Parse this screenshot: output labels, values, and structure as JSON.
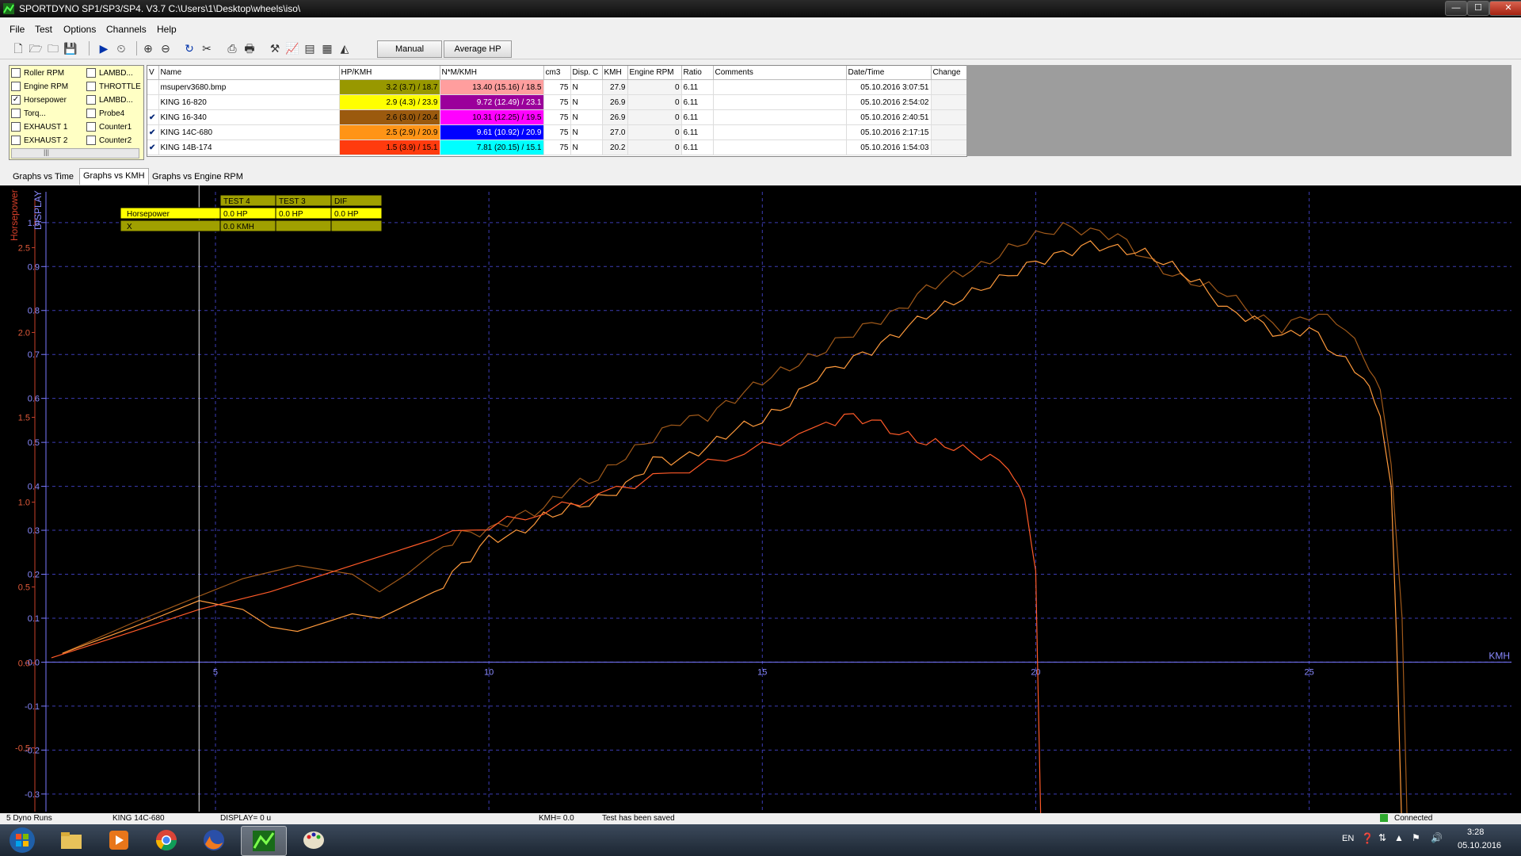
{
  "window": {
    "title": "SPORTDYNO SP1/SP3/SP4. V3.7  C:\\Users\\1\\Desktop\\wheels\\iso\\",
    "minimize": "—",
    "maximize": "☐",
    "close": "✕"
  },
  "menu": [
    "File",
    "Test",
    "Options",
    "Channels",
    "Help"
  ],
  "toolbar": {
    "manual_label": "Manual",
    "average_label": "Average HP"
  },
  "channels": [
    {
      "label": "Roller RPM",
      "checked": false
    },
    {
      "label": "LAMBD...",
      "checked": false
    },
    {
      "label": "Engine RPM",
      "checked": false
    },
    {
      "label": "THROTTLE",
      "checked": false
    },
    {
      "label": "Horsepower",
      "checked": true
    },
    {
      "label": "LAMBD...",
      "checked": false
    },
    {
      "label": "Torq...",
      "checked": false
    },
    {
      "label": "Probe4",
      "checked": false
    },
    {
      "label": "EXHAUST 1",
      "checked": false
    },
    {
      "label": "Counter1",
      "checked": false
    },
    {
      "label": "EXHAUST 2",
      "checked": false
    },
    {
      "label": "Counter2",
      "checked": false
    }
  ],
  "channels_scroll": "|||",
  "runs": {
    "headers": [
      "V",
      "Name",
      "HP/KMH",
      "N*M/KMH",
      "cm3",
      "Disp. C",
      "KMH",
      "Engine RPM",
      "Ratio",
      "Comments",
      "Date/Time",
      "Change"
    ],
    "rows": [
      {
        "checked": false,
        "name": "msuperv3680.bmp",
        "hp": "3.2 (3.7) / 18.7",
        "hp_color": "#989800",
        "nm": "13.40 (15.16) / 18.5",
        "nm_color": "#ff9e9e",
        "cm3": "75",
        "disp": "N",
        "kmh": "27.9",
        "rpm": "0",
        "ratio": "6.11",
        "comments": "",
        "date": "05.10.2016 3:07:51"
      },
      {
        "checked": false,
        "name": "KING 16-820",
        "hp": "2.9 (4.3) / 23.9",
        "hp_color": "#ffff00",
        "nm": "9.72 (12.49) / 23.1",
        "nm_color": "#9b009b",
        "cm3": "75",
        "disp": "N",
        "kmh": "26.9",
        "rpm": "0",
        "ratio": "6.11",
        "comments": "",
        "date": "05.10.2016 2:54:02"
      },
      {
        "checked": true,
        "name": "KING 16-340",
        "hp": "2.6 (3.0) / 20.4",
        "hp_color": "#9b5a0e",
        "nm": "10.31 (12.25) / 19.5",
        "nm_color": "#ff00ff",
        "cm3": "75",
        "disp": "N",
        "kmh": "26.9",
        "rpm": "0",
        "ratio": "6.11",
        "comments": "",
        "date": "05.10.2016 2:40:51"
      },
      {
        "checked": true,
        "name": "KING 14C-680",
        "hp": "2.5 (2.9) / 20.9",
        "hp_color": "#ff9416",
        "nm": "9.61 (10.92) / 20.9",
        "nm_color": "#0000ff",
        "cm3": "75",
        "disp": "N",
        "kmh": "27.0",
        "rpm": "0",
        "ratio": "6.11",
        "comments": "",
        "date": "05.10.2016 2:17:15"
      },
      {
        "checked": true,
        "name": "KING 14B-174",
        "hp": "1.5 (3.9) / 15.1",
        "hp_color": "#ff3b0e",
        "nm": "7.81 (20.15) / 15.1",
        "nm_color": "#00ffff",
        "cm3": "75",
        "disp": "N",
        "kmh": "20.2",
        "rpm": "0",
        "ratio": "6.11",
        "comments": "",
        "date": "05.10.2016 1:54:03"
      }
    ]
  },
  "tabs": [
    {
      "label": "Graphs vs Time",
      "active": false
    },
    {
      "label": "Graphs vs KMH",
      "active": true
    },
    {
      "label": "Graphs vs Engine RPM",
      "active": false
    }
  ],
  "readout": {
    "headers": [
      "TEST  4",
      "TEST  3",
      "DIF"
    ],
    "rows": [
      {
        "label": "Horsepower",
        "values": [
          "0.0 HP",
          "0.0 HP",
          "0.0 HP"
        ]
      },
      {
        "label": "X",
        "values": [
          "0.0 KMH",
          "",
          ""
        ]
      }
    ]
  },
  "chart_data": {
    "type": "line",
    "xlabel": "KMH",
    "ylabel_left": "Horsepower",
    "ylabel_right": "DISPLAY",
    "x_ticks": [
      5,
      10,
      15,
      20,
      25
    ],
    "hp_ticks": [
      "2.5",
      "2.0",
      "1.5",
      "1.0",
      "0.5",
      "0.0",
      "-0.5"
    ],
    "display_ticks": [
      "1.0",
      "0.9",
      "0.8",
      "0.7",
      "0.6",
      "0.5",
      "0.4",
      "0.3",
      "0.2",
      "0.1",
      "-0.0",
      "-0.1",
      "-0.2",
      "-0.3"
    ],
    "xlim": [
      1.9,
      28.7
    ],
    "display_ylim": [
      -0.34,
      1.07
    ],
    "grid": true,
    "cursor_x": 4.7,
    "series": [
      {
        "name": "KING 16-340",
        "color": "#a0591a",
        "x": [
          2.2,
          3.5,
          4.7,
          5.5,
          6.5,
          7.5,
          8.0,
          8.5,
          9.0,
          9.5,
          10.0,
          10.5,
          11.0,
          11.5,
          12.0,
          12.5,
          13.0,
          13.5,
          14.0,
          14.5,
          15.0,
          15.5,
          16.0,
          16.5,
          17.0,
          17.5,
          18.0,
          18.5,
          19.0,
          19.5,
          20.0,
          20.5,
          21.0,
          21.5,
          22.0,
          22.5,
          23.0,
          23.5,
          24.0,
          24.5,
          25.0,
          25.5,
          26.0,
          26.3,
          26.5,
          26.7,
          26.8
        ],
        "y": [
          0.02,
          0.09,
          0.15,
          0.19,
          0.22,
          0.2,
          0.16,
          0.2,
          0.25,
          0.29,
          0.3,
          0.33,
          0.35,
          0.4,
          0.42,
          0.47,
          0.51,
          0.55,
          0.56,
          0.6,
          0.64,
          0.67,
          0.7,
          0.74,
          0.77,
          0.8,
          0.85,
          0.88,
          0.9,
          0.94,
          0.97,
          0.99,
          0.98,
          0.97,
          0.92,
          0.88,
          0.86,
          0.84,
          0.79,
          0.76,
          0.79,
          0.78,
          0.7,
          0.62,
          0.45,
          0.1,
          -0.4
        ]
      },
      {
        "name": "KING 14C-680",
        "color": "#ff9a3c",
        "x": [
          2.2,
          3.5,
          4.7,
          5.5,
          6.0,
          6.5,
          7.0,
          7.5,
          8.0,
          8.5,
          9.0,
          9.5,
          10.0,
          10.5,
          11.0,
          11.5,
          12.0,
          12.5,
          13.0,
          13.5,
          14.0,
          14.5,
          15.0,
          15.5,
          16.0,
          16.5,
          17.0,
          17.5,
          18.0,
          18.5,
          19.0,
          19.5,
          20.0,
          20.5,
          21.0,
          21.5,
          22.0,
          22.5,
          23.0,
          23.5,
          24.0,
          24.5,
          25.0,
          25.5,
          26.0,
          26.3,
          26.5,
          26.6,
          26.7
        ],
        "y": [
          0.02,
          0.08,
          0.14,
          0.12,
          0.08,
          0.07,
          0.09,
          0.11,
          0.1,
          0.13,
          0.16,
          0.22,
          0.28,
          0.29,
          0.33,
          0.35,
          0.37,
          0.4,
          0.46,
          0.46,
          0.49,
          0.53,
          0.55,
          0.59,
          0.65,
          0.68,
          0.71,
          0.75,
          0.79,
          0.82,
          0.85,
          0.88,
          0.91,
          0.93,
          0.95,
          0.94,
          0.93,
          0.9,
          0.86,
          0.8,
          0.78,
          0.74,
          0.76,
          0.7,
          0.65,
          0.56,
          0.4,
          0.05,
          -0.4
        ]
      },
      {
        "name": "KING 14B-174",
        "color": "#ff5a28",
        "x": [
          2.0,
          3.5,
          4.7,
          6.0,
          7.0,
          8.0,
          9.0,
          10.0,
          11.0,
          12.0,
          13.0,
          14.0,
          15.0,
          16.0,
          16.5,
          17.0,
          17.5,
          18.0,
          18.5,
          19.0,
          19.5,
          19.8,
          20.0,
          20.1
        ],
        "y": [
          0.01,
          0.07,
          0.12,
          0.16,
          0.2,
          0.24,
          0.28,
          0.31,
          0.34,
          0.38,
          0.42,
          0.45,
          0.49,
          0.53,
          0.56,
          0.55,
          0.52,
          0.5,
          0.49,
          0.47,
          0.45,
          0.36,
          0.22,
          -0.4
        ]
      }
    ]
  },
  "status": {
    "runs": "5 Dyno Runs",
    "run_name": "KING 14C-680",
    "display": "DISPLAY= 0 u",
    "kmh": "KMH= 0.0",
    "message": "Test has been saved",
    "connection": "Connected"
  },
  "taskbar": {
    "lang": "EN",
    "time": "3:28",
    "date": "05.10.2016"
  }
}
